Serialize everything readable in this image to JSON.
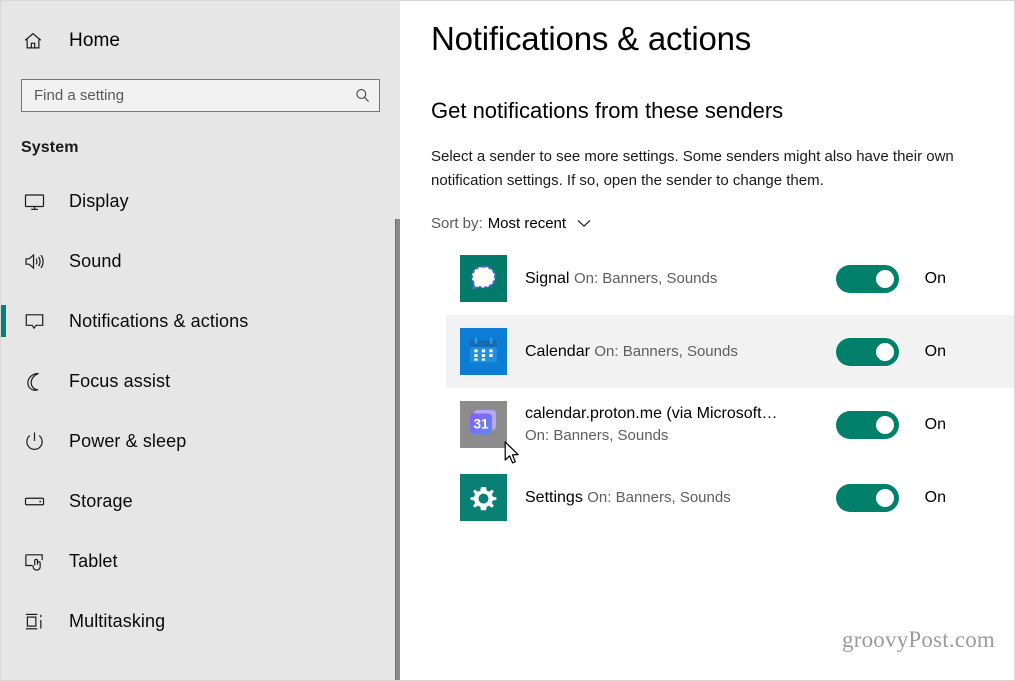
{
  "window": {
    "accent_color": "#00817a",
    "toggle_color": "#00806b",
    "sidebar_bg": "#e6e6e6"
  },
  "sidebar": {
    "home": {
      "label": "Home",
      "icon": "home-icon"
    },
    "search": {
      "placeholder": "Find a setting",
      "value": "",
      "icon": "search-icon"
    },
    "section_title": "System",
    "items": [
      {
        "label": "Display",
        "icon": "monitor-icon",
        "selected": false
      },
      {
        "label": "Sound",
        "icon": "speaker-icon",
        "selected": false
      },
      {
        "label": "Notifications & actions",
        "icon": "speech-bubble-icon",
        "selected": true
      },
      {
        "label": "Focus assist",
        "icon": "moon-icon",
        "selected": false
      },
      {
        "label": "Power & sleep",
        "icon": "power-icon",
        "selected": false
      },
      {
        "label": "Storage",
        "icon": "drive-icon",
        "selected": false
      },
      {
        "label": "Tablet",
        "icon": "tablet-touch-icon",
        "selected": false
      },
      {
        "label": "Multitasking",
        "icon": "multitasking-icon",
        "selected": false
      }
    ]
  },
  "main": {
    "page_title": "Notifications & actions",
    "section_heading": "Get notifications from these senders",
    "description": "Select a sender to see more settings. Some senders might also have their own notification settings. If so, open the sender to change them.",
    "sort": {
      "label": "Sort by:",
      "value": "Most recent",
      "chevron_icon": "chevron-down-icon"
    },
    "senders": [
      {
        "name": "Signal",
        "status": "On: Banners, Sounds",
        "toggle_on": true,
        "toggle_label": "On",
        "icon": "signal-app-icon",
        "tile_color": "#047a6b",
        "hovered": false
      },
      {
        "name": "Calendar",
        "status": "On: Banners, Sounds",
        "toggle_on": true,
        "toggle_label": "On",
        "icon": "calendar-app-icon",
        "tile_color": "#0c7cd5",
        "hovered": true
      },
      {
        "name": "calendar.proton.me (via Microsoft…",
        "status": "On: Banners, Sounds",
        "toggle_on": true,
        "toggle_label": "On",
        "icon": "proton-calendar-app-icon",
        "tile_color": "#8a8a8a",
        "hovered": false
      },
      {
        "name": "Settings",
        "status": "On: Banners, Sounds",
        "toggle_on": true,
        "toggle_label": "On",
        "icon": "settings-gear-app-icon",
        "tile_color": "#0a8074",
        "hovered": false
      }
    ],
    "watermark": "groovyPost.com"
  }
}
